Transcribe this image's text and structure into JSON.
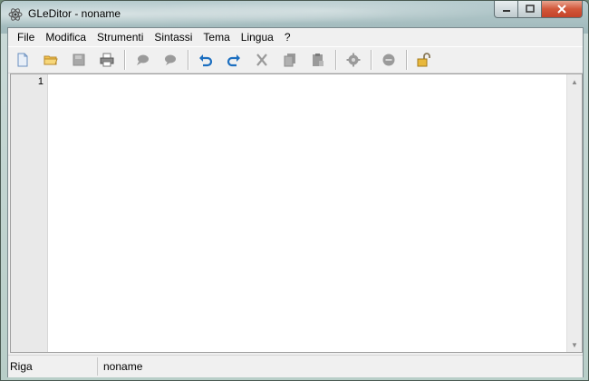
{
  "window": {
    "title": "GLeDitor - noname"
  },
  "menu": [
    {
      "label": "File"
    },
    {
      "label": "Modifica"
    },
    {
      "label": "Strumenti"
    },
    {
      "label": "Sintassi"
    },
    {
      "label": "Tema"
    },
    {
      "label": "Lingua"
    },
    {
      "label": "?"
    }
  ],
  "toolbar": [
    "new-file-icon",
    "open-folder-icon",
    "save-icon",
    "print-icon",
    "comment-icon",
    "uncomment-icon",
    "undo-icon",
    "redo-icon",
    "cut-icon",
    "copy-icon",
    "paste-icon",
    "settings-icon",
    "stop-icon",
    "lock-icon"
  ],
  "editor": {
    "line_numbers": [
      "1"
    ]
  },
  "status": {
    "line_label": "Riga",
    "file_name": "noname"
  },
  "colors": {
    "accent_blue": "#1c6fc0",
    "close_red": "#c4432a",
    "toolbar_gray": "#9a9a9a"
  }
}
